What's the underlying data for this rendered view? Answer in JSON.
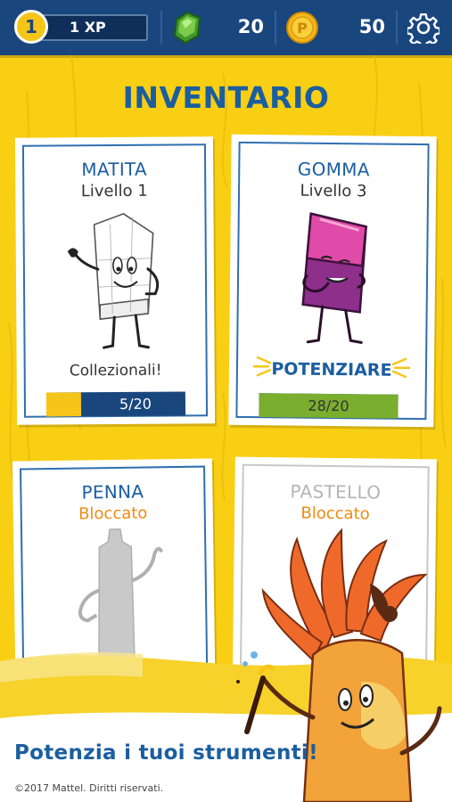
{
  "topbar": {
    "level": "1",
    "xp_label": "1 XP",
    "xp_fraction": 0.06,
    "gems": "20",
    "coins": "50",
    "coin_letter": "P",
    "icons": {
      "gem": "gem-icon",
      "coin": "coin-icon",
      "settings": "gear-icon"
    }
  },
  "title": "INVENTARIO",
  "cards": [
    {
      "name": "MATITA",
      "level": "Livello 1",
      "note": "Collezionali!",
      "progress_label": "5/20",
      "progress": 0.25
    },
    {
      "name": "GOMMA",
      "level": "Livello 3",
      "action": "POTENZIARE",
      "progress_label": "28/20",
      "progress": 1.0
    },
    {
      "name": "PENNA",
      "status": "Bloccato"
    },
    {
      "name": "PASTELLO",
      "status": "Bloccato"
    }
  ],
  "banner": {
    "text": "Potenzia i tuoi strumenti!"
  },
  "footer": {
    "copyright": "©2017 Mattel. Diritti riservati."
  },
  "colors": {
    "background": "#f9cf14",
    "topbar": "#1a467e",
    "accent_blue": "#1b5ea0",
    "locked_orange": "#f08a10",
    "progress_yellow": "#f6c519",
    "progress_green": "#7aae2e"
  }
}
